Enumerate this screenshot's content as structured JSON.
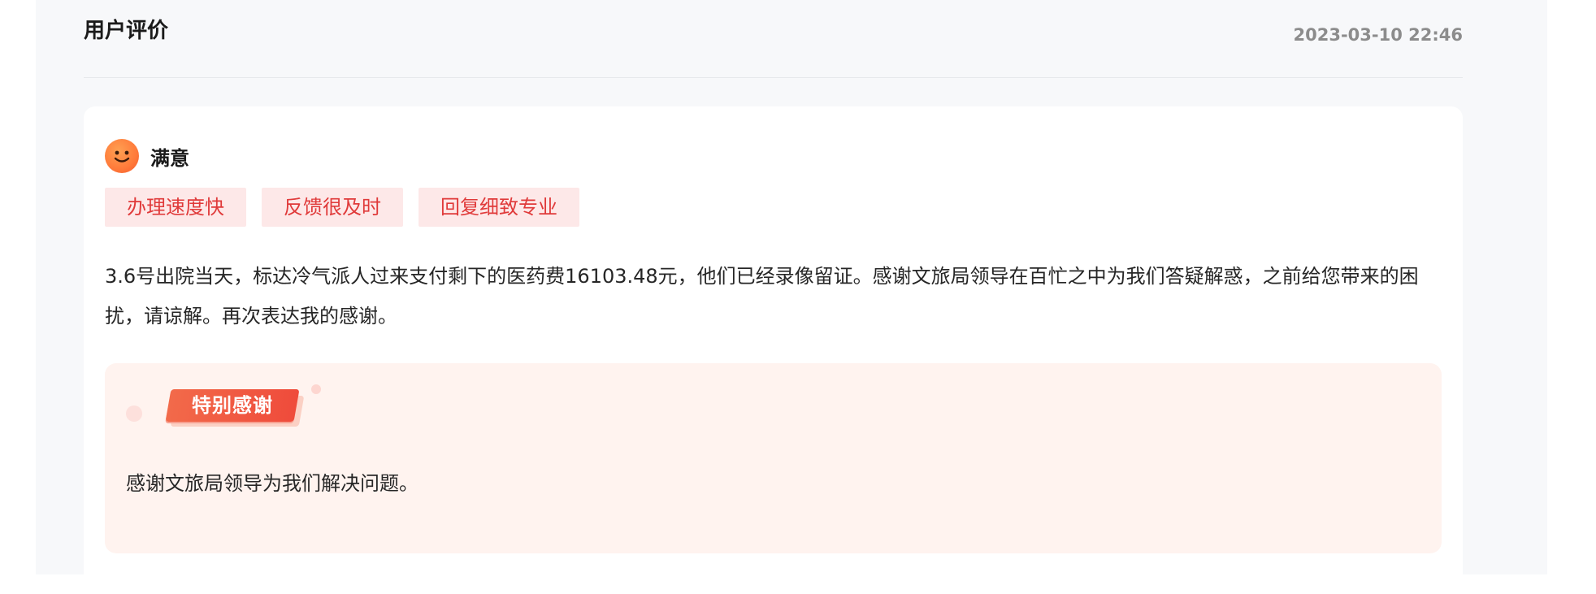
{
  "header": {
    "title": "用户评价",
    "timestamp": "2023-03-10 22:46"
  },
  "review": {
    "rating_icon": "smiley-face-icon",
    "rating_label": "满意",
    "tags": [
      "办理速度快",
      "反馈很及时",
      "回复细致专业"
    ],
    "content": "3.6号出院当天，标达冷气派人过来支付剩下的医药费16103.48元，他们已经录像留证。感谢文旅局领导在百忙之中为我们答疑解惑，之前给您带来的困扰，请谅解。再次表达我的感谢。"
  },
  "special_thanks": {
    "badge_label": "特别感谢",
    "text": "感谢文旅局领导为我们解决问题。"
  },
  "colors": {
    "tag_background": "#fde8e8",
    "tag_text": "#e03a3a",
    "badge": "#ef4b3b",
    "thanks_background": "#fff3ef"
  }
}
